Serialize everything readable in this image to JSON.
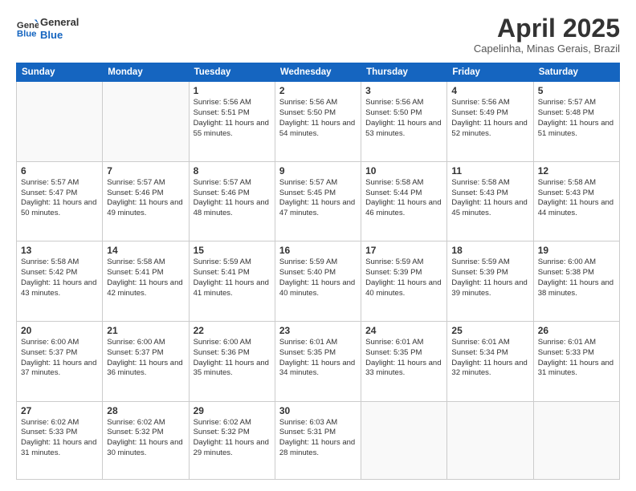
{
  "header": {
    "logo_line1": "General",
    "logo_line2": "Blue",
    "month": "April 2025",
    "location": "Capelinha, Minas Gerais, Brazil"
  },
  "weekdays": [
    "Sunday",
    "Monday",
    "Tuesday",
    "Wednesday",
    "Thursday",
    "Friday",
    "Saturday"
  ],
  "weeks": [
    [
      {
        "day": "",
        "info": ""
      },
      {
        "day": "",
        "info": ""
      },
      {
        "day": "1",
        "info": "Sunrise: 5:56 AM\nSunset: 5:51 PM\nDaylight: 11 hours and 55 minutes."
      },
      {
        "day": "2",
        "info": "Sunrise: 5:56 AM\nSunset: 5:50 PM\nDaylight: 11 hours and 54 minutes."
      },
      {
        "day": "3",
        "info": "Sunrise: 5:56 AM\nSunset: 5:50 PM\nDaylight: 11 hours and 53 minutes."
      },
      {
        "day": "4",
        "info": "Sunrise: 5:56 AM\nSunset: 5:49 PM\nDaylight: 11 hours and 52 minutes."
      },
      {
        "day": "5",
        "info": "Sunrise: 5:57 AM\nSunset: 5:48 PM\nDaylight: 11 hours and 51 minutes."
      }
    ],
    [
      {
        "day": "6",
        "info": "Sunrise: 5:57 AM\nSunset: 5:47 PM\nDaylight: 11 hours and 50 minutes."
      },
      {
        "day": "7",
        "info": "Sunrise: 5:57 AM\nSunset: 5:46 PM\nDaylight: 11 hours and 49 minutes."
      },
      {
        "day": "8",
        "info": "Sunrise: 5:57 AM\nSunset: 5:46 PM\nDaylight: 11 hours and 48 minutes."
      },
      {
        "day": "9",
        "info": "Sunrise: 5:57 AM\nSunset: 5:45 PM\nDaylight: 11 hours and 47 minutes."
      },
      {
        "day": "10",
        "info": "Sunrise: 5:58 AM\nSunset: 5:44 PM\nDaylight: 11 hours and 46 minutes."
      },
      {
        "day": "11",
        "info": "Sunrise: 5:58 AM\nSunset: 5:43 PM\nDaylight: 11 hours and 45 minutes."
      },
      {
        "day": "12",
        "info": "Sunrise: 5:58 AM\nSunset: 5:43 PM\nDaylight: 11 hours and 44 minutes."
      }
    ],
    [
      {
        "day": "13",
        "info": "Sunrise: 5:58 AM\nSunset: 5:42 PM\nDaylight: 11 hours and 43 minutes."
      },
      {
        "day": "14",
        "info": "Sunrise: 5:58 AM\nSunset: 5:41 PM\nDaylight: 11 hours and 42 minutes."
      },
      {
        "day": "15",
        "info": "Sunrise: 5:59 AM\nSunset: 5:41 PM\nDaylight: 11 hours and 41 minutes."
      },
      {
        "day": "16",
        "info": "Sunrise: 5:59 AM\nSunset: 5:40 PM\nDaylight: 11 hours and 40 minutes."
      },
      {
        "day": "17",
        "info": "Sunrise: 5:59 AM\nSunset: 5:39 PM\nDaylight: 11 hours and 40 minutes."
      },
      {
        "day": "18",
        "info": "Sunrise: 5:59 AM\nSunset: 5:39 PM\nDaylight: 11 hours and 39 minutes."
      },
      {
        "day": "19",
        "info": "Sunrise: 6:00 AM\nSunset: 5:38 PM\nDaylight: 11 hours and 38 minutes."
      }
    ],
    [
      {
        "day": "20",
        "info": "Sunrise: 6:00 AM\nSunset: 5:37 PM\nDaylight: 11 hours and 37 minutes."
      },
      {
        "day": "21",
        "info": "Sunrise: 6:00 AM\nSunset: 5:37 PM\nDaylight: 11 hours and 36 minutes."
      },
      {
        "day": "22",
        "info": "Sunrise: 6:00 AM\nSunset: 5:36 PM\nDaylight: 11 hours and 35 minutes."
      },
      {
        "day": "23",
        "info": "Sunrise: 6:01 AM\nSunset: 5:35 PM\nDaylight: 11 hours and 34 minutes."
      },
      {
        "day": "24",
        "info": "Sunrise: 6:01 AM\nSunset: 5:35 PM\nDaylight: 11 hours and 33 minutes."
      },
      {
        "day": "25",
        "info": "Sunrise: 6:01 AM\nSunset: 5:34 PM\nDaylight: 11 hours and 32 minutes."
      },
      {
        "day": "26",
        "info": "Sunrise: 6:01 AM\nSunset: 5:33 PM\nDaylight: 11 hours and 31 minutes."
      }
    ],
    [
      {
        "day": "27",
        "info": "Sunrise: 6:02 AM\nSunset: 5:33 PM\nDaylight: 11 hours and 31 minutes."
      },
      {
        "day": "28",
        "info": "Sunrise: 6:02 AM\nSunset: 5:32 PM\nDaylight: 11 hours and 30 minutes."
      },
      {
        "day": "29",
        "info": "Sunrise: 6:02 AM\nSunset: 5:32 PM\nDaylight: 11 hours and 29 minutes."
      },
      {
        "day": "30",
        "info": "Sunrise: 6:03 AM\nSunset: 5:31 PM\nDaylight: 11 hours and 28 minutes."
      },
      {
        "day": "",
        "info": ""
      },
      {
        "day": "",
        "info": ""
      },
      {
        "day": "",
        "info": ""
      }
    ]
  ]
}
